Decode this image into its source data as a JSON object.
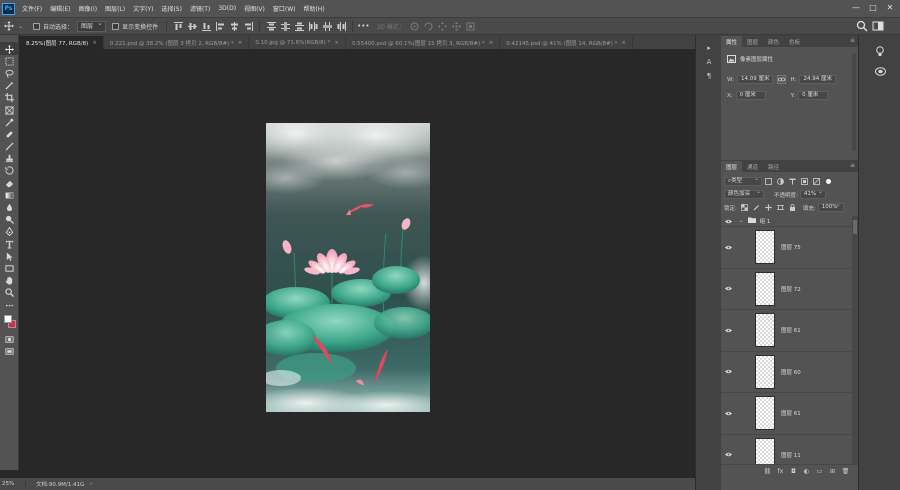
{
  "app": {
    "logo": "Ps"
  },
  "menu": [
    "文件(F)",
    "编辑(E)",
    "图像(I)",
    "图层(L)",
    "文字(Y)",
    "选择(S)",
    "滤镜(T)",
    "3D(D)",
    "视图(V)",
    "窗口(W)",
    "帮助(H)"
  ],
  "window_controls": {
    "minimize": "—",
    "maximize": "□",
    "close": "✕"
  },
  "options": {
    "auto_select_label": "自动选择：",
    "auto_select_value": "图层",
    "show_transform_label": "显示变换控件",
    "more": "•••",
    "mode_3d_label": "3D 模式："
  },
  "tabs": [
    {
      "label": "8.25%(图层 77, RGB/8)",
      "active": true
    },
    {
      "label": "0.221.psd @ 38.2% (图层 3 拷贝 2, RGB/8#) *",
      "active": false
    },
    {
      "label": "0.10.jpg @ 71.6%(RGB/8) *",
      "active": false
    },
    {
      "label": "0.55400.psd @ 60.1%(图层 15 拷贝 3, RGB/8#) *",
      "active": false
    },
    {
      "label": "0.42145.psd @ 41% (图层 14, RGB/8#) *",
      "active": false
    }
  ],
  "tab_close": "×",
  "status": {
    "zoom": "25%",
    "doc": "文档:90.9M/1.41G",
    "arrow": "›"
  },
  "icon_dock": [
    "▸",
    "A",
    "¶"
  ],
  "properties": {
    "tabs": [
      "属性",
      "图层",
      "颜色",
      "色板"
    ],
    "title": "像素图层属性",
    "w_label": "W:",
    "w_value": "14.09 厘米",
    "h_label": "H:",
    "h_value": "24.94 厘米",
    "x_label": "X:",
    "x_value": "0 厘米",
    "y_label": "Y:",
    "y_value": "0 厘米"
  },
  "layers_panel": {
    "tabs": [
      "图层",
      "通道",
      "路径"
    ],
    "filter_kind": "类型",
    "blend_mode": "颜色加深",
    "opacity_label": "不透明度:",
    "opacity_value": "41%",
    "lock_label": "锁定:",
    "fill_label": "填充:",
    "fill_value": "100%",
    "group_name": "组 1",
    "layers": [
      {
        "name": "图层 75"
      },
      {
        "name": "图层 72"
      },
      {
        "name": "图层 61"
      },
      {
        "name": "图层 60"
      },
      {
        "name": "图层 61"
      },
      {
        "name": "图层 11"
      }
    ],
    "footer": [
      "⛓",
      "fx",
      "◘",
      "◐",
      "▭",
      "⊞",
      "🗑"
    ]
  },
  "menu_glyph": "≡",
  "colors": {
    "accent": "#31a8ff",
    "background_swatch": "#e3244f",
    "foreground_swatch": "#ffffff"
  }
}
